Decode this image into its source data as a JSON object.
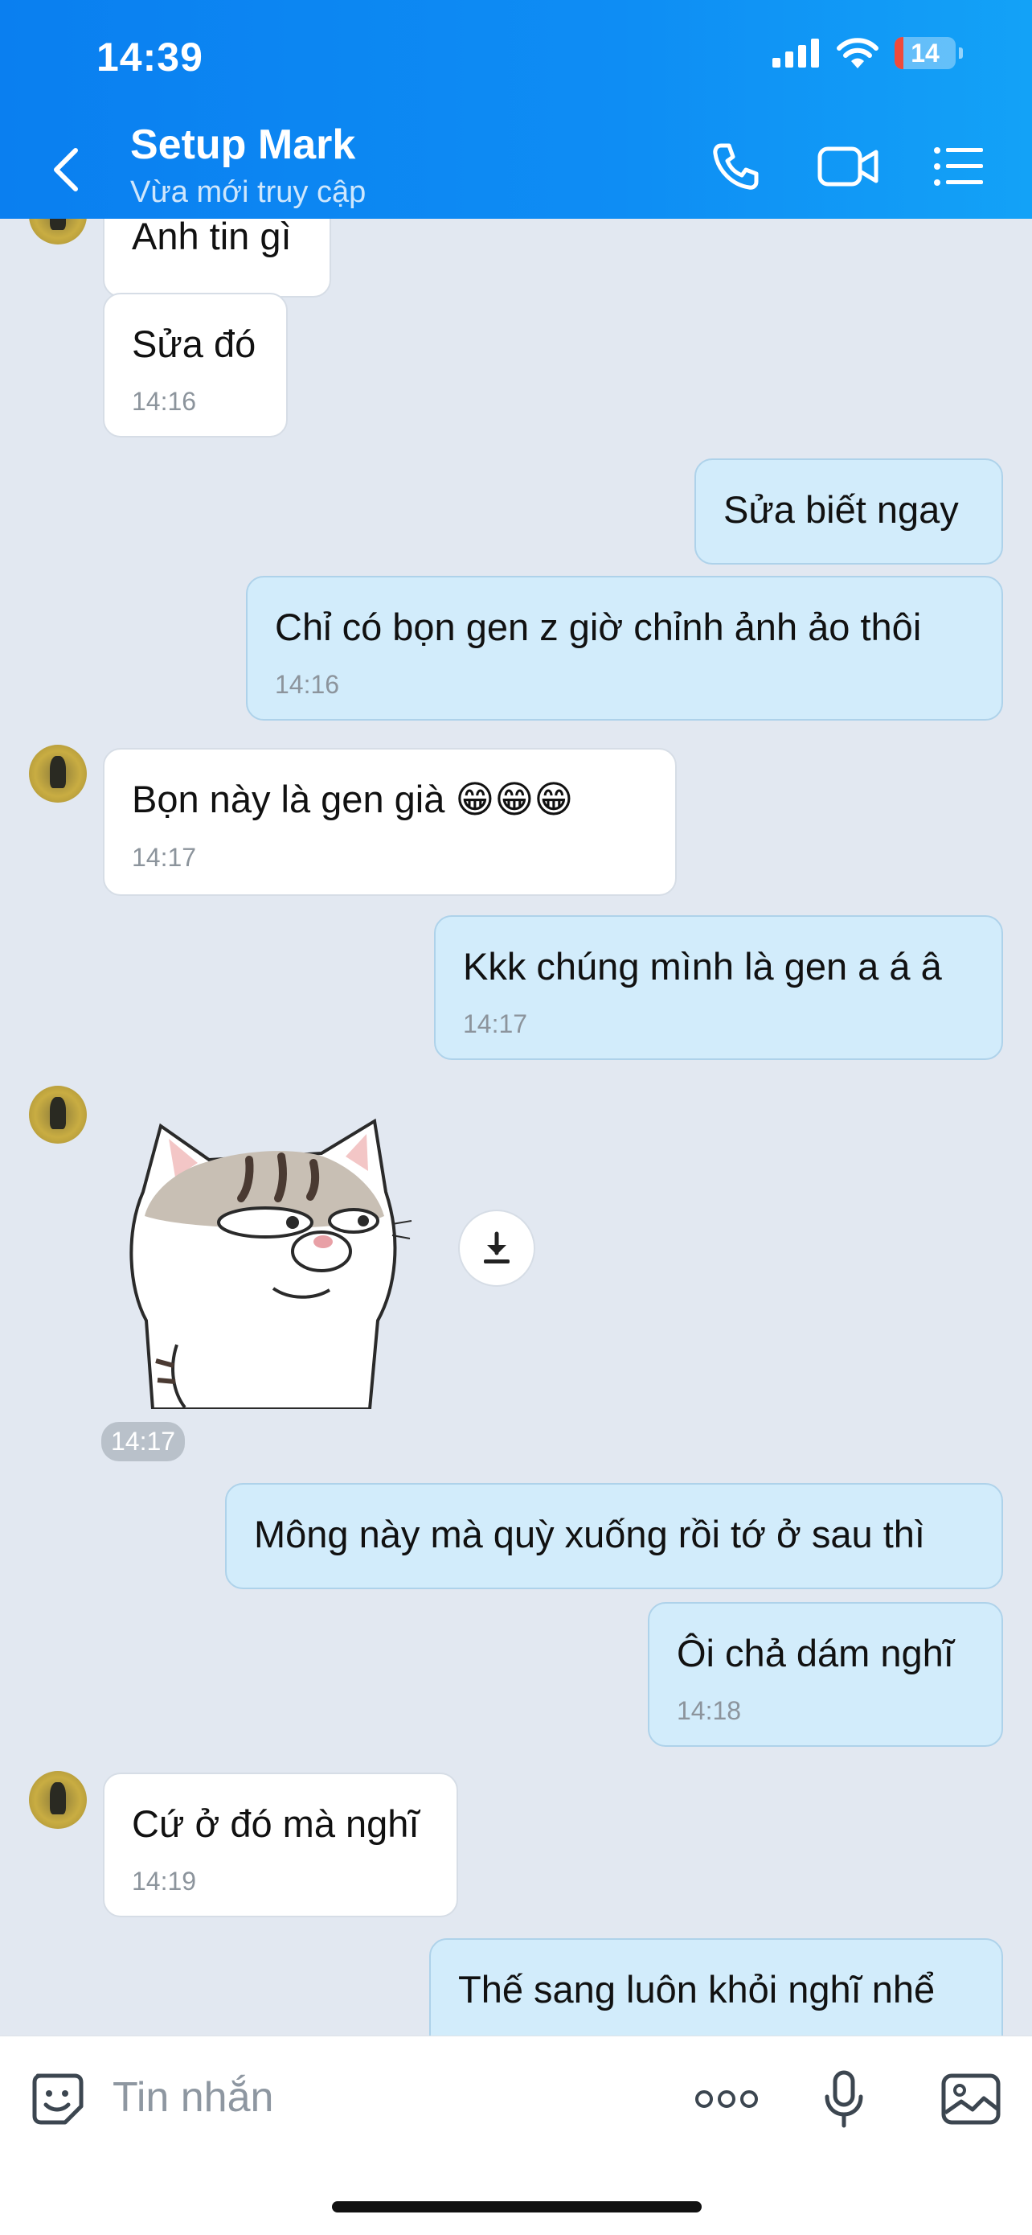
{
  "status_bar": {
    "time": "14:39",
    "battery": "14"
  },
  "header": {
    "contact_name": "Setup Mark",
    "status": "Vừa mới truy cập",
    "icons": [
      "back-icon",
      "phone-icon",
      "video-call-icon",
      "menu-list-icon"
    ]
  },
  "messages": [
    {
      "dir": "in",
      "text": "Anh tin gì",
      "time": ""
    },
    {
      "dir": "in",
      "text": "Sửa đó",
      "time": "14:16"
    },
    {
      "dir": "out",
      "text": "Sửa biết ngay",
      "time": ""
    },
    {
      "dir": "out",
      "text": "Chỉ có bọn gen z giờ chỉnh ảnh ảo thôi",
      "time": "14:16"
    },
    {
      "dir": "in",
      "text": "Bọn này là gen già 😁😁😁",
      "time": "14:17"
    },
    {
      "dir": "out",
      "text": "Kkk chúng mình là gen a á â",
      "time": "14:17"
    },
    {
      "dir": "in",
      "type": "sticker",
      "time": "14:17"
    },
    {
      "dir": "out",
      "text": "Mông này mà quỳ xuống rồi tớ ở sau thì",
      "time": ""
    },
    {
      "dir": "out",
      "text": "Ôi chả dám nghĩ",
      "time": "14:18"
    },
    {
      "dir": "in",
      "text": "Cứ ở đó mà nghĩ",
      "time": "14:19"
    },
    {
      "dir": "out",
      "text": "Thế sang luôn khỏi nghĩ nhể",
      "time": ""
    }
  ],
  "input": {
    "placeholder": "Tin nhắn"
  },
  "colors": {
    "header": "#0a7ff0",
    "bubble_out": "#d2ecfb",
    "bubble_in": "#ffffff",
    "chat_bg": "#e2e8f1"
  }
}
